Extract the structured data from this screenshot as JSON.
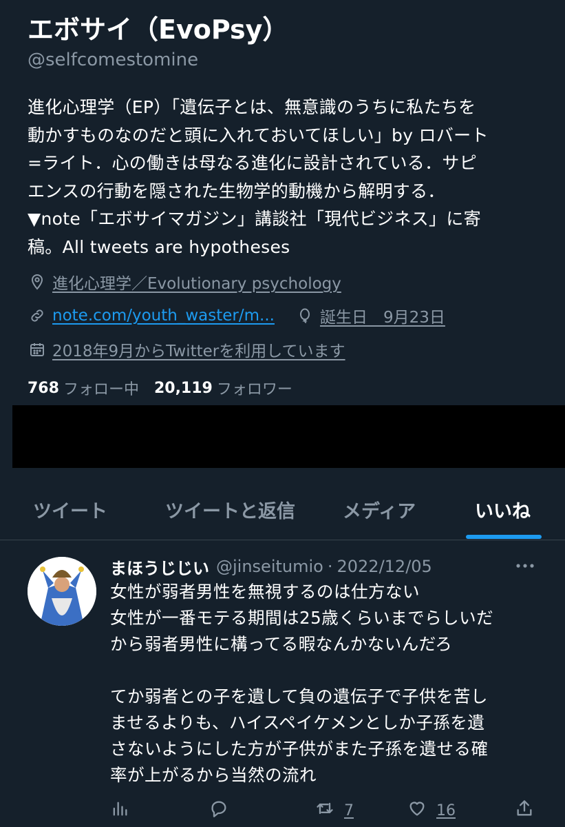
{
  "profile": {
    "name": "エボサイ（EvoPsy）",
    "handle": "@selfcomestomine",
    "bio_lines": [
      "進化心理学（EP）「遺伝子とは、無意識のうちに私たちを",
      "動かすものなのだと頭に入れておいてほしい」by ロバート",
      "=ライト．心の働きは母なる進化に設計されている．サピ",
      "エンスの行動を隠された生物学的動機から解明する．",
      "▼note「エボサイマガジン」講談社「現代ビジネス」に寄",
      "稿。All tweets are hypotheses"
    ],
    "location": "進化心理学／Evolutionary psychology",
    "website": "note.com/youth_waster/m...",
    "birthday": "誕生日　9月23日",
    "joined": "2018年9月からTwitterを利用しています",
    "following_count": "768",
    "following_label": "フォロー中",
    "followers_count": "20,119",
    "followers_label": "フォロワー"
  },
  "tabs": {
    "items": [
      {
        "label": "ツイート"
      },
      {
        "label": "ツイートと返信"
      },
      {
        "label": "メディア"
      },
      {
        "label": "いいね"
      }
    ],
    "active": "いいね"
  },
  "tweet": {
    "author": "まほうじじい",
    "handle": "@jinseitumio",
    "separator": "·",
    "date": "2022/12/05",
    "lines_1": [
      "女性が弱者男性を無視するのは仕方ない",
      "女性が一番モテる期間は25歳くらいまでらしいだ",
      "から弱者男性に構ってる暇なんかないんだろ"
    ],
    "lines_2": [
      "てか弱者との子を遺して負の遺伝子で子供を苦し",
      "ませるよりも、ハイスペイケメンとしか子孫を遺",
      "さないようにした方が子供がまた子孫を遺せる確",
      "率が上がるから当然の流れ"
    ],
    "retweet_count": "7",
    "like_count": "16"
  },
  "icons": [
    "location-icon",
    "link-icon",
    "birthday-icon",
    "calendar-icon",
    "more-icon",
    "analytics-icon",
    "reply-icon",
    "retweet-icon",
    "like-icon",
    "share-icon"
  ],
  "colors": {
    "background": "#15202b",
    "text_primary": "#ffffff",
    "text_secondary": "#8b98a5",
    "accent": "#1d9bf0",
    "divider": "#38444d"
  }
}
